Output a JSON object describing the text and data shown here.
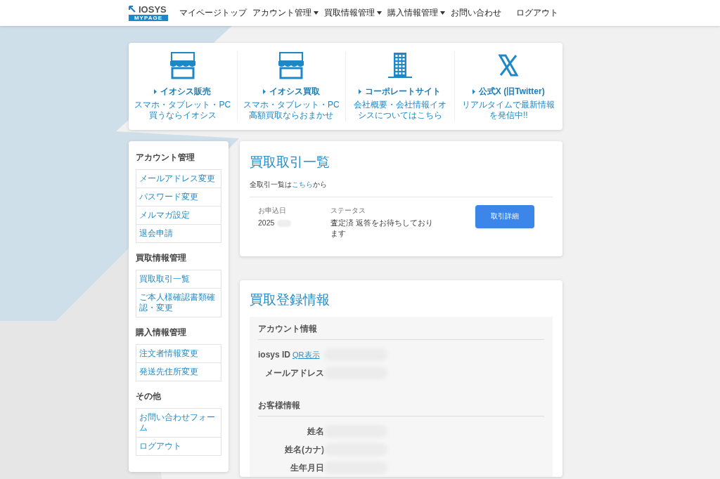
{
  "header": {
    "logo": {
      "name": "IOSYS",
      "sub": "MYPAGE"
    },
    "nav": [
      {
        "label": "マイページトップ",
        "dropdown": false
      },
      {
        "label": "アカウント管理",
        "dropdown": true
      },
      {
        "label": "買取情報管理",
        "dropdown": true
      },
      {
        "label": "購入情報管理",
        "dropdown": true
      },
      {
        "label": "お問い合わせ",
        "dropdown": false
      }
    ],
    "logout": "ログアウト"
  },
  "links": [
    {
      "kind": "shop",
      "title": "イオシス販売",
      "text": "スマホ・タブレット・PC買うならイオシス"
    },
    {
      "kind": "shop",
      "title": "イオシス買取",
      "text": "スマホ・タブレット・PC高額買取ならおまかせ"
    },
    {
      "kind": "building",
      "title": "コーポレートサイト",
      "text": "会社概要・会社情報イオシスについてはこちら"
    },
    {
      "kind": "x",
      "title": "公式X (旧Twitter)",
      "text": "リアルタイムで最新情報を発信中!!"
    }
  ],
  "sidebar": [
    {
      "heading": "アカウント管理",
      "items": [
        "メールアドレス変更",
        "パスワード変更",
        "メルマガ設定",
        "退会申請"
      ]
    },
    {
      "heading": "買取情報管理",
      "items": [
        "買取取引一覧",
        "ご本人様確認書類確認・変更"
      ]
    },
    {
      "heading": "購入情報管理",
      "items": [
        "注文者情報変更",
        "発送先住所変更"
      ]
    },
    {
      "heading": "その他",
      "items": [
        "お問い合わせフォーム",
        "ログアウト"
      ]
    }
  ],
  "transactions": {
    "title": "買取取引一覧",
    "note_before": "全取引一覧は",
    "note_link": "こちら",
    "note_after": "から",
    "date_label": "お申込日",
    "date": "2025",
    "status_label": "ステータス",
    "status": "査定済 返答をお待ちしております",
    "button": "取引詳細"
  },
  "registration": {
    "title": "買取登録情報",
    "sections": [
      {
        "heading": "アカウント情報",
        "rows": [
          {
            "label": "iosys ID",
            "link": "QR表示"
          },
          {
            "label": "メールアドレス"
          }
        ]
      },
      {
        "heading": "お客様情報",
        "rows": [
          {
            "label": "姓名"
          },
          {
            "label": "姓名(カナ)"
          },
          {
            "label": "生年月日"
          }
        ]
      }
    ]
  }
}
